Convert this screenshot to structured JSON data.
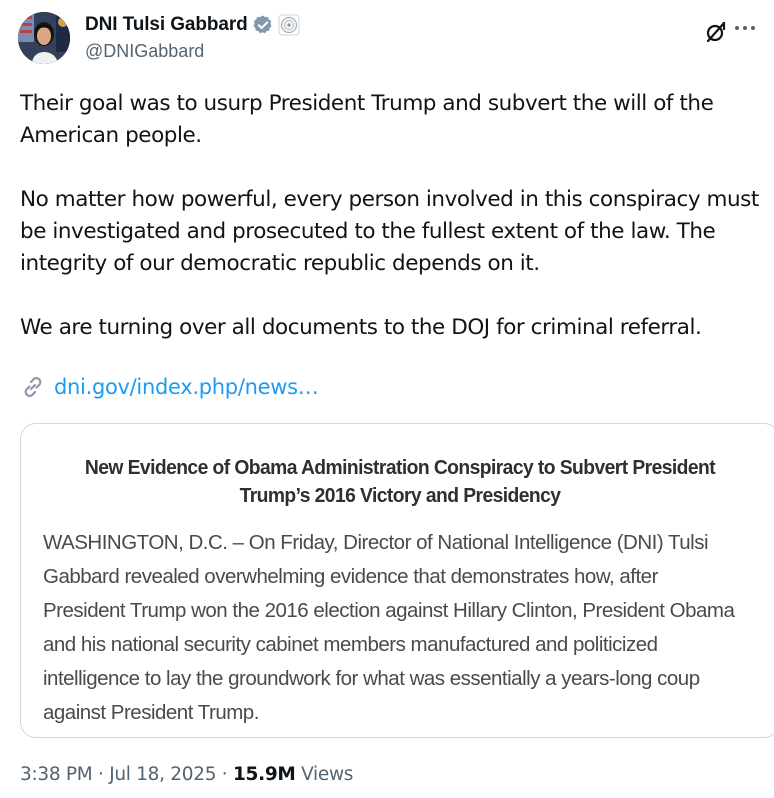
{
  "author": {
    "name": "DNI Tulsi Gabbard",
    "handle": "@DNIGabbard",
    "verified_badge_color": "#829aab"
  },
  "header_icons": {
    "grok": "grok-icon",
    "more": "more-icon"
  },
  "tweet": {
    "paragraphs": [
      "Their goal was to usurp President Trump and subvert the will of the American people.",
      "No matter how powerful, every person involved in this conspiracy must be investigated and prosecuted to the fullest extent of the law. The integrity of our democratic republic depends on it.",
      "We are turning over all documents to the DOJ for criminal referral."
    ],
    "link_text": "dni.gov/index.php/news…",
    "link_color": "#1d9bf0"
  },
  "card": {
    "title_line1": "New Evidence of Obama Administration Conspiracy to Subvert President",
    "title_line2": "Trump’s 2016 Victory and Presidency",
    "body_lines": [
      "WASHINGTON, D.C. – On Friday, Director of National Intelligence (DNI) Tulsi",
      "Gabbard revealed overwhelming evidence that demonstrates how, after",
      "President Trump won the 2016 election against Hillary Clinton, President Obama",
      "and his national security cabinet members manufactured and politicized",
      "intelligence to lay the groundwork for what was essentially a years-long coup",
      "against President Trump."
    ]
  },
  "meta": {
    "time": "3:38 PM",
    "separator": " · ",
    "date": "Jul 18, 2025",
    "views_count": "15.9M",
    "views_label": "Views"
  }
}
